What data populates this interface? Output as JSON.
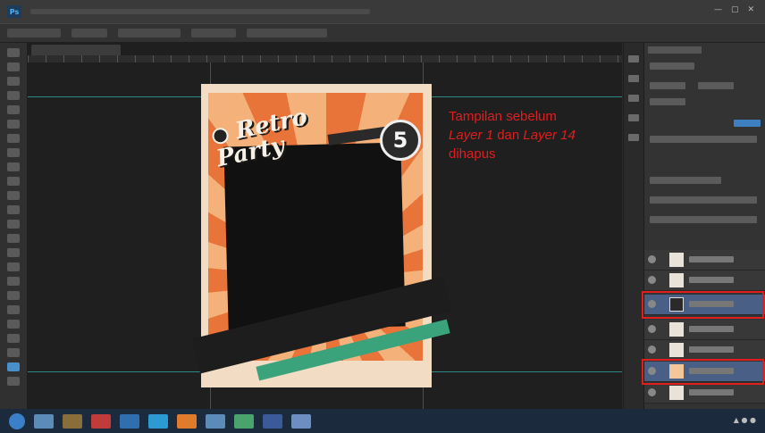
{
  "app": {
    "name": "Photoshop",
    "logo_text": "Ps"
  },
  "canvas": {
    "poster": {
      "title_line1": "Retro",
      "title_line2": "Party",
      "badge_number": "5"
    }
  },
  "annotation": {
    "line1": "Tampilan sebelum",
    "layer1": "Layer 1",
    "conj": " dan ",
    "layer14": "Layer 14",
    "line3": "dihapus"
  },
  "colors": {
    "annotation": "#e01e1e",
    "guide": "#2e8a86",
    "selection": "#4a5f86"
  },
  "taskbar": {
    "apps": [
      "explorer",
      "media",
      "mail",
      "browser",
      "files",
      "photoshop",
      "word",
      "chrome"
    ]
  }
}
